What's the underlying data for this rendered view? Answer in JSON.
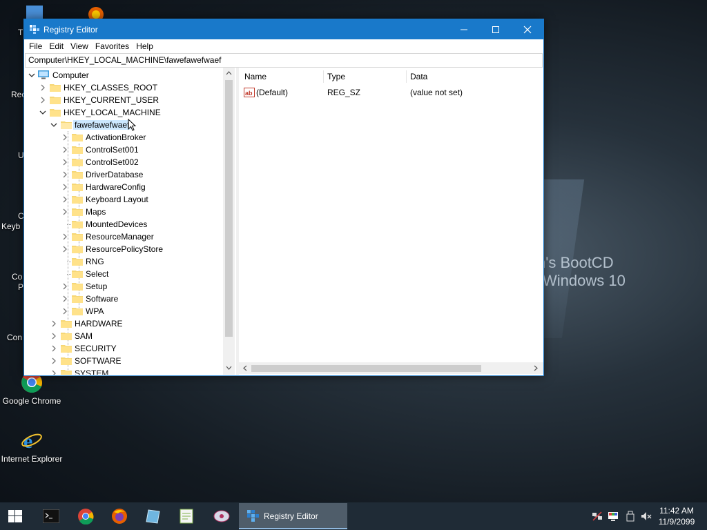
{
  "window": {
    "title": "Registry Editor",
    "menu": [
      "File",
      "Edit",
      "View",
      "Favorites",
      "Help"
    ],
    "address": "Computer\\HKEY_LOCAL_MACHINE\\fawefawefwaef"
  },
  "tree": {
    "root": "Computer",
    "hives": {
      "classes_root": "HKEY_CLASSES_ROOT",
      "current_user": "HKEY_CURRENT_USER",
      "local_machine": "HKEY_LOCAL_MACHINE"
    },
    "selected": "fawefawefwaef",
    "children": [
      "ActivationBroker",
      "ControlSet001",
      "ControlSet002",
      "DriverDatabase",
      "HardwareConfig",
      "Keyboard Layout",
      "Maps",
      "MountedDevices",
      "ResourceManager",
      "ResourcePolicyStore",
      "RNG",
      "Select",
      "Setup",
      "Software",
      "WPA"
    ],
    "lm_keys": [
      "HARDWARE",
      "SAM",
      "SECURITY",
      "SOFTWARE",
      "SYSTEM"
    ]
  },
  "values": {
    "columns": {
      "name": "Name",
      "type": "Type",
      "data": "Data"
    },
    "rows": [
      {
        "name": "(Default)",
        "type": "REG_SZ",
        "data": "(value not set)"
      }
    ]
  },
  "desktop": {
    "icons": {
      "chrome": "Google Chrome",
      "ie": "Internet Explorer"
    },
    "partial_labels": [
      "T",
      "Rec",
      "U",
      "C",
      "Keyb",
      "Co",
      "P",
      "Con"
    ],
    "wallpaper": [
      "n's BootCD",
      "Windows 10"
    ]
  },
  "taskbar": {
    "active_label": "Registry Editor",
    "time": "11:42 AM",
    "date": "11/9/2099"
  },
  "colors": {
    "accent": "#1979ca",
    "selection": "#cce8ff",
    "taskbar": "#1f2b36"
  }
}
